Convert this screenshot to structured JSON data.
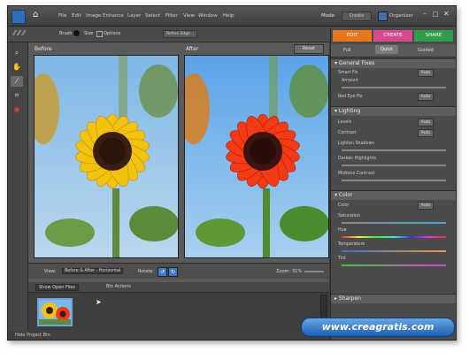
{
  "menu": [
    "File",
    "Edit",
    "Image",
    "Enhance",
    "Layer",
    "Select",
    "Filter",
    "View",
    "Window",
    "Help"
  ],
  "modes": {
    "mode": "Mode",
    "create": "Create",
    "organizer": "Organizer"
  },
  "toolbar": {
    "brush": "Brush",
    "size": "Size",
    "options": "Options",
    "refine": "Refine Edge..."
  },
  "tabs": {
    "edit": "EDIT",
    "create": "CREATE",
    "share": "SHARE"
  },
  "subtabs": {
    "full": "Full",
    "quick": "Quick",
    "guided": "Guided"
  },
  "canvas": {
    "before": "Before",
    "after": "After",
    "reset": "Reset"
  },
  "sections": {
    "general": {
      "title": "General Fixes",
      "smart_fix": "Smart Fix",
      "amount": "Amount",
      "red_eye": "Red Eye Fix",
      "auto": "Auto"
    },
    "lighting": {
      "title": "Lighting",
      "levels": "Levels",
      "contrast": "Contrast",
      "shadows": "Lighten Shadows",
      "highlights": "Darken Highlights",
      "midtone": "Midtone Contrast",
      "auto": "Auto"
    },
    "color": {
      "title": "Color",
      "color": "Color",
      "saturation": "Saturation",
      "hue": "Hue",
      "temperature": "Temperature",
      "tint": "Tint",
      "auto": "Auto"
    },
    "sharpen": {
      "title": "Sharpen"
    }
  },
  "controls": {
    "view_label": "View:",
    "view_value": "Before & After - Horizontal",
    "rotate": "Rotate:",
    "zoom_label": "Zoom:",
    "zoom_value": "31%"
  },
  "bin": {
    "show": "Show Open Files",
    "bin_actions": "Bin Actions"
  },
  "status": {
    "text": "Hide Project Bin"
  },
  "watermark": {
    "text": "www.creagratis.com"
  }
}
